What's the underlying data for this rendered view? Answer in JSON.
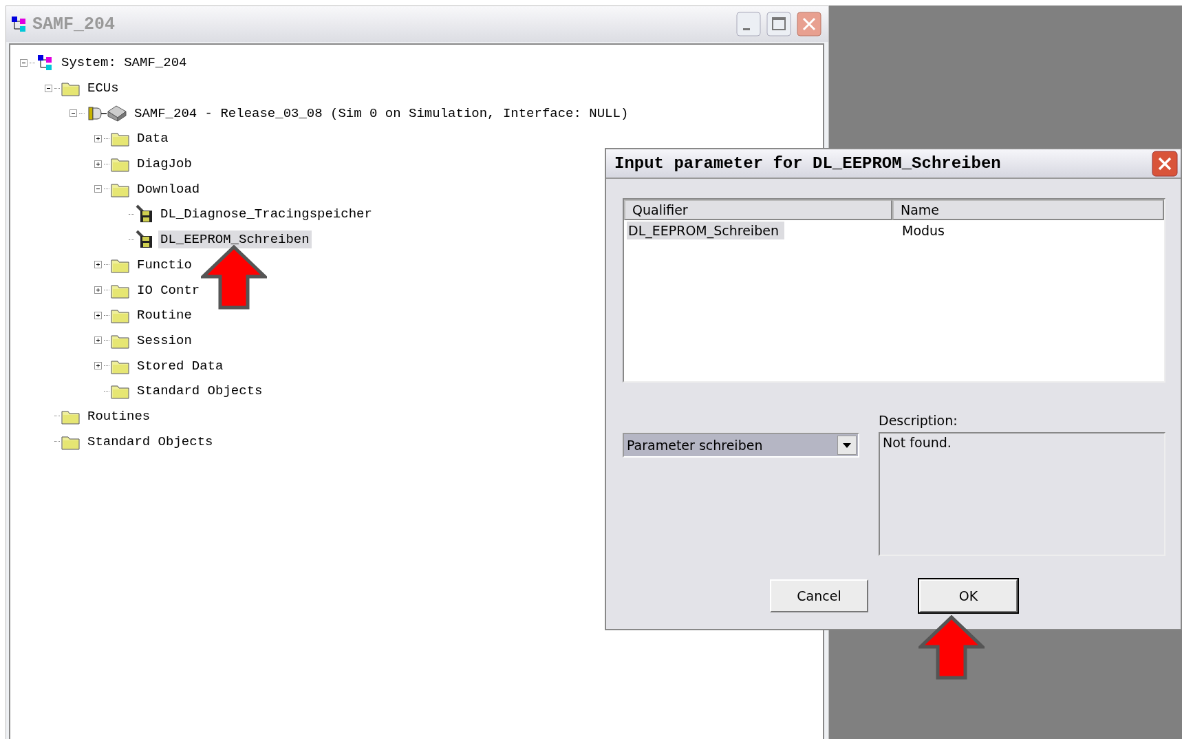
{
  "window": {
    "title": "SAMF_204"
  },
  "tree": [
    {
      "kind": "system",
      "label": "System: SAMF_204",
      "expanded": true,
      "selected": false,
      "children": [
        {
          "kind": "folder",
          "label": "ECUs",
          "expanded": true,
          "selected": false,
          "children": [
            {
              "kind": "ecu",
              "label": "SAMF_204 - Release_03_08 (Sim 0 on Simulation, Interface: NULL)",
              "expanded": true,
              "selected": false,
              "children": [
                {
                  "kind": "folder",
                  "label": "Data",
                  "expanded": false,
                  "selected": false
                },
                {
                  "kind": "folder",
                  "label": "DiagJob",
                  "expanded": false,
                  "selected": false
                },
                {
                  "kind": "folder",
                  "label": "Download",
                  "expanded": true,
                  "selected": false,
                  "children": [
                    {
                      "kind": "job",
                      "label": "DL_Diagnose_Tracingspeicher",
                      "selected": false
                    },
                    {
                      "kind": "job",
                      "label": "DL_EEPROM_Schreiben",
                      "selected": true
                    }
                  ]
                },
                {
                  "kind": "folder",
                  "label": "Functio",
                  "expanded": false,
                  "selected": false
                },
                {
                  "kind": "folder",
                  "label": "IO Contr",
                  "expanded": false,
                  "selected": false
                },
                {
                  "kind": "folder",
                  "label": "Routine",
                  "expanded": false,
                  "selected": false
                },
                {
                  "kind": "folder",
                  "label": "Session",
                  "expanded": false,
                  "selected": false
                },
                {
                  "kind": "folder",
                  "label": "Stored Data",
                  "expanded": false,
                  "selected": false
                },
                {
                  "kind": "folder",
                  "label": "Standard Objects",
                  "selected": false
                }
              ]
            }
          ]
        },
        {
          "kind": "folder",
          "label": "Routines",
          "selected": false
        },
        {
          "kind": "folder",
          "label": "Standard Objects",
          "selected": false
        }
      ]
    }
  ],
  "dialog": {
    "title": "Input parameter for DL_EEPROM_Schreiben",
    "table": {
      "columns": [
        "Qualifier",
        "Name"
      ],
      "rows": [
        {
          "cells": [
            "DL_EEPROM_Schreiben",
            "Modus"
          ],
          "selected": true
        }
      ]
    },
    "dropdown": {
      "value": "Parameter schreiben"
    },
    "description_label": "Description:",
    "description": "Not found.",
    "buttons": [
      {
        "label": "Cancel",
        "default": false
      },
      {
        "label": "OK",
        "default": true
      }
    ]
  }
}
